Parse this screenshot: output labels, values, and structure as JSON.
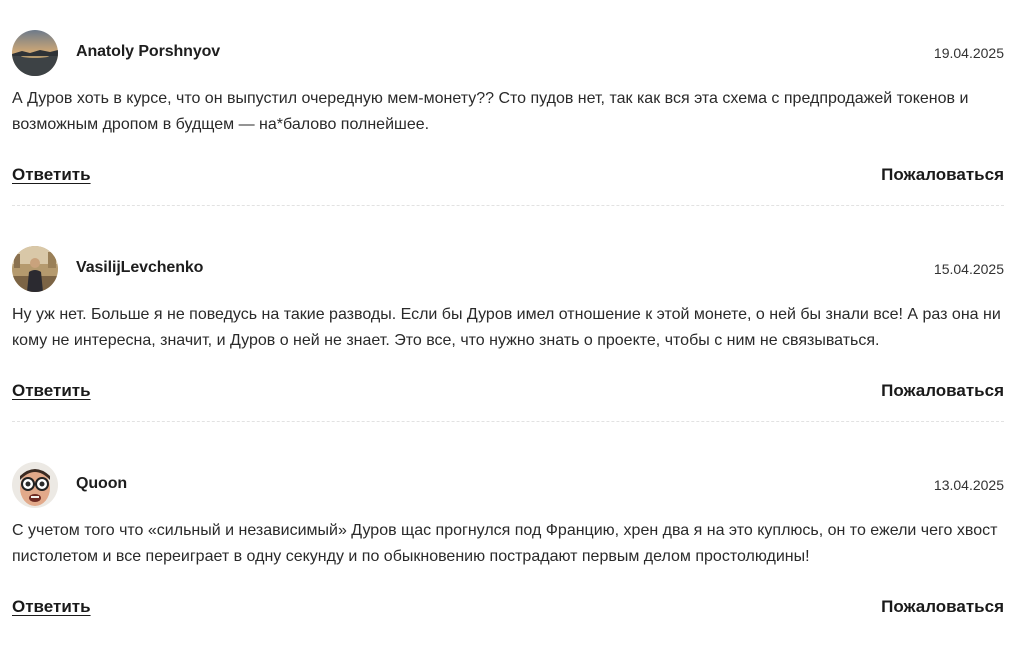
{
  "comments": [
    {
      "author": "Anatoly Porshnyov",
      "date": "19.04.2025",
      "text": "А Дуров хоть в курсе, что он выпустил очередную мем-монету?? Сто пудов нет, так как вся эта схема с предпродажей токенов и возможным дропом в будщем — на*балово полнейшее.",
      "reply_label": "Ответить",
      "report_label": "Пожаловаться",
      "avatar_icon": "sunset-landscape-avatar"
    },
    {
      "author": "VasilijLevchenko",
      "date": "15.04.2025",
      "text": "Ну уж нет. Больше я не поведусь на такие разводы. Если бы Дуров имел отношение к этой монете, о ней бы знали все! А раз она ни кому не интересна, значит, и Дуров о ней не знает. Это все, что нужно знать о проекте, чтобы с ним не связываться.",
      "reply_label": "Ответить",
      "report_label": "Пожаловаться",
      "avatar_icon": "person-photo-avatar"
    },
    {
      "author": "Quoon",
      "date": "13.04.2025",
      "text": "С учетом того что «сильный и независимый» Дуров щас прогнулся под Францию, хрен два я на это куплюсь, он то ежели чего хвост пистолетом и все переиграет в одну секунду и по обыкновению пострадают первым делом простолюдины!",
      "reply_label": "Ответить",
      "report_label": "Пожаловаться",
      "avatar_icon": "face-with-glasses-avatar"
    }
  ],
  "colors": {
    "text": "#2a2a2a",
    "link": "#1a1a1a",
    "divider": "#e2e2e2"
  }
}
